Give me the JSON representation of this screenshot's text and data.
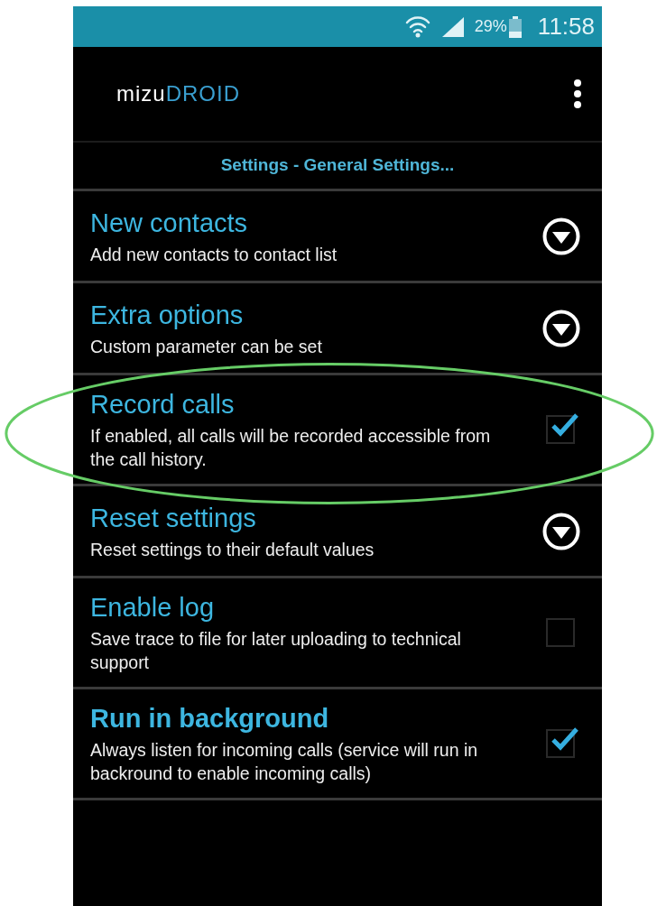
{
  "status_bar": {
    "battery": "29%",
    "time": "11:58"
  },
  "app_bar": {
    "logo": {
      "light": "mizu",
      "accent": "DROID"
    }
  },
  "header": {
    "title": "Settings - General Settings..."
  },
  "rows": [
    {
      "kind": "dropdown",
      "title": "New contacts",
      "summary": "Add new contacts to contact list",
      "bold": false,
      "highlighted": false
    },
    {
      "kind": "dropdown",
      "title": "Extra options",
      "summary": "Custom parameter can be set",
      "bold": false,
      "highlighted": false
    },
    {
      "kind": "checkbox",
      "title": "Record calls",
      "summary": "If enabled, all calls will be recorded accessible from the call history.",
      "checked": true,
      "bold": false,
      "highlighted": true
    },
    {
      "kind": "dropdown",
      "title": "Reset settings",
      "summary": "Reset settings to their default values",
      "bold": false,
      "highlighted": false
    },
    {
      "kind": "checkbox",
      "title": "Enable log",
      "summary": "Save trace to file for later uploading to technical support",
      "checked": false,
      "bold": false,
      "highlighted": false
    },
    {
      "kind": "checkbox",
      "title": "Run in background",
      "summary": "Always listen for incoming calls (service will run in backround to enable incoming calls)",
      "checked": true,
      "bold": true,
      "highlighted": false
    }
  ]
}
